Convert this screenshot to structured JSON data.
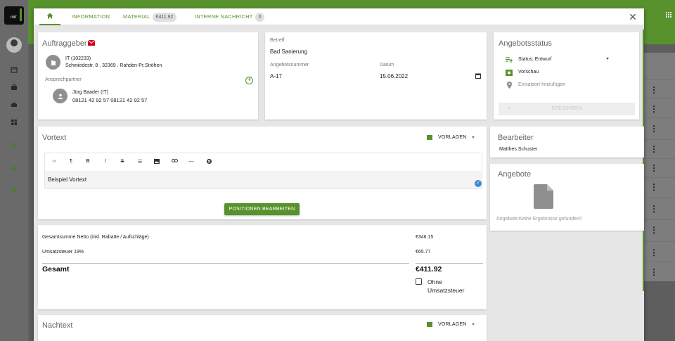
{
  "app": {
    "logo_text": "mtr"
  },
  "tabs": {
    "information": "INFORMATION",
    "material": "MATERIAL",
    "material_badge": "€411,92",
    "messages": "INTERNE NACHRICHT",
    "messages_badge": "0"
  },
  "client": {
    "title": "Auftraggeber",
    "company_id": "IT (102233)",
    "address": "Schmiedestr. 8 , 32369 , Rahden-Pr.Ströhen",
    "contact_label": "Ansprechpartner",
    "contact_name": "Jürg Baader (IT)",
    "contact_phone": "08121 42 92 57 08121 42 92 57"
  },
  "subject": {
    "label": "Betreff",
    "value": "Bad Sanierung",
    "number_label": "Angebotsnummer",
    "number_value": "A-17",
    "date_label": "Datum",
    "date_value": "15.06.2022"
  },
  "status": {
    "title": "Angebotsstatus",
    "status_text": "Status: Entwurf",
    "preview": "Vorschau",
    "location": "Einsatzort hinzufügen",
    "save": "SPEICHERN"
  },
  "vortext": {
    "title": "Vortext",
    "templates": "VORLAGEN",
    "body": "Beispiel Vortext"
  },
  "positions_button": "POSITIONEN BEARBEITEN",
  "totals": {
    "net_label": "Gesamtsumme Netto (inkl. Rabatte / Aufschläge)",
    "net_value": "€346.15",
    "tax_label": "Umsatzsteuer 19%",
    "tax_value": "€65.77",
    "total_label": "Gesamt",
    "total_value": "€411.92",
    "no_tax_line1": "Ohne",
    "no_tax_line2": "Umsatzsteuer"
  },
  "editor": {
    "title": "Bearbeiter",
    "name": "Matthes Schuster"
  },
  "offers": {
    "title": "Angebote",
    "empty": "Angebote:Keine Ergebnisse gefunden!!"
  },
  "nachtext": {
    "title": "Nachtext",
    "templates": "VORLAGEN"
  },
  "colors": {
    "accent": "#58922c",
    "danger": "#d0021b",
    "bar_bg": "#58922c"
  }
}
